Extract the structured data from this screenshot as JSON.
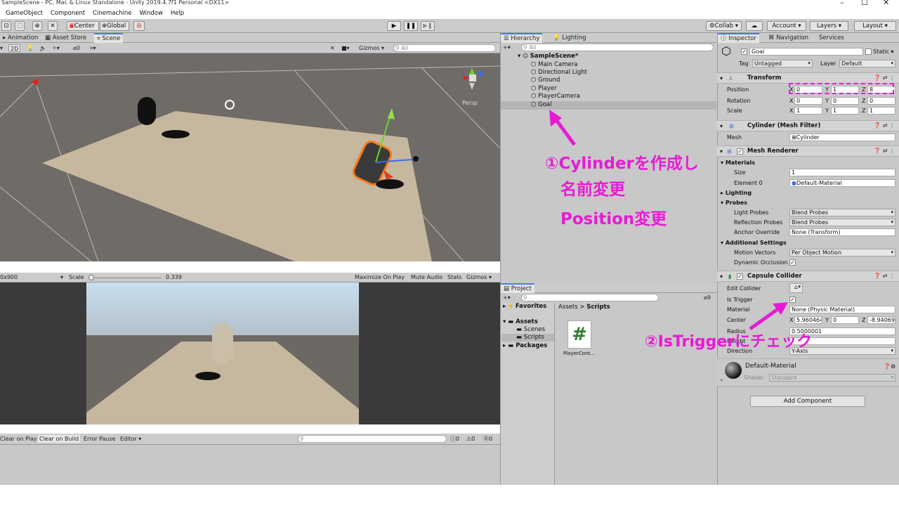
{
  "window": {
    "title": "SampleScene - PC, Mac & Linux Standalone - Unity 2019.4.7f1 Personal <DX11>",
    "minimize": "–",
    "maximize": "☐",
    "close": "✕"
  },
  "menu": [
    "GameObject",
    "Component",
    "Cinemachine",
    "Window",
    "Help"
  ],
  "toolbar": {
    "pivot": "Center",
    "space": "Global",
    "collab": "Collab",
    "account": "Account",
    "layers": "Layers",
    "layout": "Layout"
  },
  "scene_tabs": {
    "animation": "Animation",
    "asset_store": "Asset Store",
    "scene": "Scene"
  },
  "scene_toolbar": {
    "mode_2d": "2D",
    "gizmos": "Gizmos",
    "search": "All",
    "persp": "Persp",
    "stat": "0"
  },
  "game_toolbar": {
    "resolution": "0x900",
    "scale_label": "Scale",
    "scale_value": "0.339",
    "maximize": "Maximize On Play",
    "mute": "Mute Audio",
    "stats": "Stats",
    "gizmos": "Gizmos"
  },
  "console": {
    "clear": "Clear on Play",
    "clear_build": "Clear on Build",
    "error_pause": "Error Pause",
    "editor": "Editor",
    "count_info": "0",
    "count_warn": "0",
    "count_error": "0"
  },
  "hierarchy": {
    "tab": "Hierarchy",
    "lighting_tab": "Lighting",
    "search": "All",
    "scene": "SampleScene*",
    "items": [
      "Main Camera",
      "Directional Light",
      "Ground",
      "Player",
      "PlayerCamera",
      "Goal"
    ]
  },
  "project": {
    "tab": "Project",
    "favorites": "Favorites",
    "assets": "Assets",
    "scenes": "Scenes",
    "scripts": "Scripts",
    "packages": "Packages",
    "breadcrumb_root": "Assets",
    "breadcrumb_sep": ">",
    "breadcrumb_current": "Scripts",
    "file": "PlayerCont...",
    "file_icon": "#",
    "count": "9"
  },
  "inspector": {
    "tab": "Inspector",
    "nav_tab": "Navigation",
    "services_tab": "Services",
    "object_name": "Goal",
    "static": "Static",
    "tag_label": "Tag",
    "tag": "Untagged",
    "layer_label": "Layer",
    "layer": "Default",
    "transform": {
      "title": "Transform",
      "position_label": "Position",
      "rotation_label": "Rotation",
      "scale_label": "Scale",
      "position": [
        "0",
        "1",
        "8"
      ],
      "rotation": [
        "0",
        "0",
        "0"
      ],
      "scale": [
        "1",
        "1",
        "1"
      ]
    },
    "axes": [
      "X",
      "Y",
      "Z"
    ],
    "mesh_filter": {
      "title": "Cylinder (Mesh Filter)",
      "mesh_label": "Mesh",
      "mesh": "Cylinder"
    },
    "mesh_renderer": {
      "title": "Mesh Renderer",
      "materials": "Materials",
      "size_label": "Size",
      "size": "1",
      "element_label": "Element 0",
      "element": "Default-Material",
      "lighting": "Lighting",
      "probes": "Probes",
      "light_probes_label": "Light Probes",
      "light_probes": "Blend Probes",
      "reflection_label": "Reflection Probes",
      "reflection": "Blend Probes",
      "anchor_label": "Anchor Override",
      "anchor": "None (Transform)",
      "additional": "Additional Settings",
      "motion_label": "Motion Vectors",
      "motion": "Per Object Motion",
      "occlusion_label": "Dynamic Occlusion"
    },
    "capsule": {
      "title": "Capsule Collider",
      "edit_label": "Edit Collider",
      "trigger_label": "Is Trigger",
      "material_label": "Material",
      "material": "None (Physic Material)",
      "center_label": "Center",
      "center": [
        "5.960464",
        "0",
        "-8.94069"
      ],
      "radius_label": "Radius",
      "radius": "0.5000001",
      "height_label": "Height",
      "direction_label": "Direction",
      "direction": "Y-Axis"
    },
    "material": {
      "name": "Default-Material",
      "shader_label": "Shader",
      "shader": "Standard"
    },
    "add_component": "Add Component"
  },
  "annotations": {
    "note1_line1": "①Cylinderを作成し",
    "note1_line2": "名前変更",
    "note1_line3": "Position変更",
    "note2": "②IsTriggerにチェック"
  },
  "colors": {
    "annotation": "#e81ad6",
    "selection": "#ff7a1a",
    "accent": "#4a7ed8"
  }
}
